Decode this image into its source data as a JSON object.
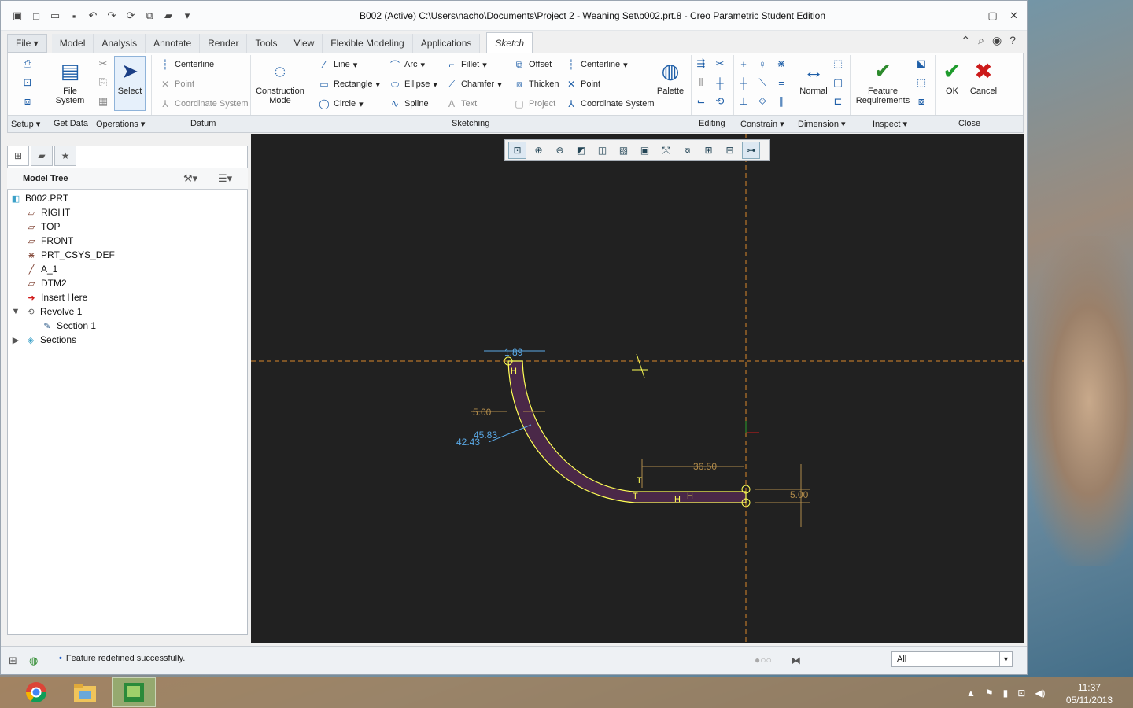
{
  "window": {
    "title": "B002 (Active) C:\\Users\\nacho\\Documents\\Project 2 - Weaning Set\\b002.prt.8 - Creo Parametric Student Edition"
  },
  "tabs": [
    {
      "label": "File ▾"
    },
    {
      "label": "Model"
    },
    {
      "label": "Analysis"
    },
    {
      "label": "Annotate"
    },
    {
      "label": "Render"
    },
    {
      "label": "Tools"
    },
    {
      "label": "View"
    },
    {
      "label": "Flexible Modeling"
    },
    {
      "label": "Applications"
    },
    {
      "label": "Sketch"
    }
  ],
  "ribbon": {
    "file_system": "File System",
    "select": "Select",
    "datum": {
      "centerline": "Centerline",
      "point": "Point",
      "csys": "Coordinate System"
    },
    "construction_mode": "Construction Mode",
    "sketching": {
      "line": "Line",
      "rectangle": "Rectangle",
      "circle": "Circle",
      "arc": "Arc",
      "ellipse": "Ellipse",
      "spline": "Spline",
      "fillet": "Fillet",
      "chamfer": "Chamfer",
      "text": "Text",
      "offset": "Offset",
      "thicken": "Thicken",
      "project": "Project",
      "centerline": "Centerline",
      "point": "Point",
      "csys": "Coordinate System",
      "palette": "Palette"
    },
    "normal": "Normal",
    "feature_requirements": "Feature Requirements",
    "ok": "OK",
    "cancel": "Cancel",
    "groups": {
      "setup": "Setup ▾",
      "get_data": "Get Data",
      "operations": "Operations ▾",
      "datum": "Datum",
      "sketching": "Sketching",
      "editing": "Editing",
      "constrain": "Constrain ▾",
      "dimension": "Dimension ▾",
      "inspect": "Inspect ▾",
      "close": "Close"
    }
  },
  "model_tree": {
    "header": "Model Tree",
    "items": [
      {
        "label": "B002.PRT",
        "icon": "part-icon"
      },
      {
        "label": "RIGHT",
        "icon": "datum-plane-icon"
      },
      {
        "label": "TOP",
        "icon": "datum-plane-icon"
      },
      {
        "label": "FRONT",
        "icon": "datum-plane-icon"
      },
      {
        "label": "PRT_CSYS_DEF",
        "icon": "csys-icon"
      },
      {
        "label": "A_1",
        "icon": "axis-icon"
      },
      {
        "label": "DTM2",
        "icon": "datum-plane-icon"
      },
      {
        "label": "Insert Here",
        "icon": "insert-arrow-icon"
      },
      {
        "label": "Revolve 1",
        "icon": "revolve-icon"
      },
      {
        "label": "Section 1",
        "icon": "sketch-icon"
      },
      {
        "label": "Sections",
        "icon": "sections-icon"
      }
    ]
  },
  "sketch": {
    "dims": {
      "d1": "1.89",
      "d2": "5.00",
      "d3": "45.83",
      "d4": "42.43",
      "d5": "36.50",
      "d6": "5.00"
    },
    "constraints": {
      "h": "H",
      "t": "T"
    }
  },
  "status": {
    "message": "Feature redefined successfully.",
    "filter_value": "All"
  },
  "taskbar": {
    "time": "11:37",
    "date": "05/11/2013"
  },
  "colors": {
    "canvas_bg": "#212121",
    "sketch_fill": "#4a2848",
    "sketch_edge": "#ffff55",
    "dim_strong": "#5aa9e6",
    "dim_weak": "#b08a4a",
    "ref_line": "#d9882a"
  }
}
